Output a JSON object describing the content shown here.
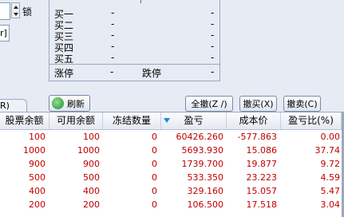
{
  "top_controls": {
    "lock_label": "锁",
    "combo_text": "r]"
  },
  "quote_panel": {
    "rows": [
      {
        "label": "买一",
        "v1": "-",
        "v2": "-"
      },
      {
        "label": "买二",
        "v1": "-",
        "v2": "-"
      },
      {
        "label": "买三",
        "v1": "-",
        "v2": "-"
      },
      {
        "label": "买四",
        "v1": "-",
        "v2": "-"
      },
      {
        "label": "买五",
        "v1": "-",
        "v2": "-"
      }
    ],
    "limit_up_label": "涨停",
    "limit_up_value": "-",
    "limit_down_label": "跌停",
    "limit_down_value": "-"
  },
  "tab_label": "R)",
  "toolbar": {
    "refresh_label": "刷新",
    "cancel_all_label": "全撤(Z /)",
    "cancel_buy_label": "撤买(X)",
    "cancel_sell_label": "撤卖(C)"
  },
  "table": {
    "headers": [
      "股票余额",
      "可用余额",
      "冻结数量",
      "盈亏",
      "成本价",
      "盈亏比(%)"
    ],
    "rows": [
      [
        "100",
        "100",
        "0",
        "60426.260",
        "-577.863",
        "0.00"
      ],
      [
        "1000",
        "1000",
        "0",
        "5693.930",
        "15.086",
        "37.74"
      ],
      [
        "900",
        "900",
        "0",
        "1739.700",
        "19.877",
        "9.72"
      ],
      [
        "500",
        "500",
        "0",
        "533.350",
        "23.223",
        "4.59"
      ],
      [
        "400",
        "400",
        "0",
        "329.160",
        "15.057",
        "5.47"
      ],
      [
        "200",
        "200",
        "0",
        "106.500",
        "17.518",
        "3.04"
      ]
    ]
  },
  "colors": {
    "value_color": "#c00000",
    "sort_indicator": "#1a8fd0"
  }
}
